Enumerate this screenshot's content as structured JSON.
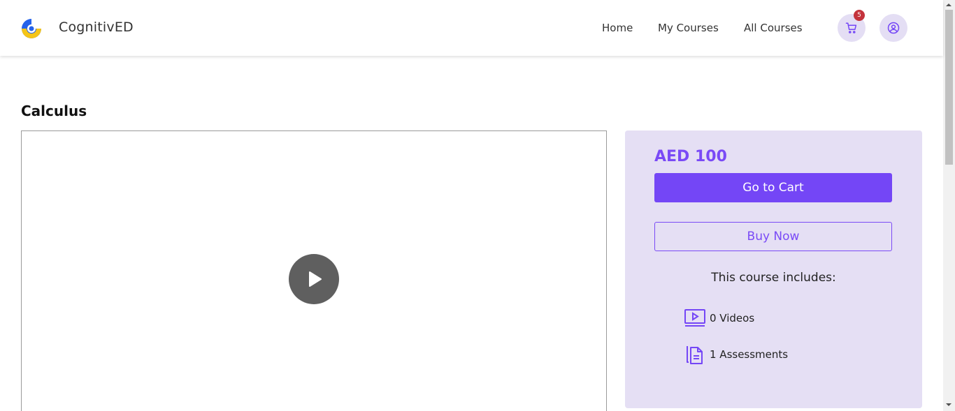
{
  "header": {
    "brand": "CognitivED",
    "nav": [
      "Home",
      "My Courses",
      "All Courses"
    ],
    "cart_count": "5"
  },
  "course": {
    "title": "Calculus"
  },
  "purchase": {
    "price": "AED 100",
    "go_to_cart": "Go to Cart",
    "buy_now": "Buy Now",
    "includes_heading": "This course includes:",
    "videos": "0 Videos",
    "assessments": "1 Assessments"
  },
  "colors": {
    "accent": "#7446f6",
    "panel_bg": "#e5dff4",
    "badge": "#c4333c",
    "logo_blue": "#2563eb",
    "logo_yellow": "#f5c518"
  },
  "icons": {
    "logo": "cognitived-logo-icon",
    "cart": "cart-icon",
    "account": "user-circle-icon",
    "play": "play-icon",
    "videos": "video-player-icon",
    "assessments": "document-icon"
  }
}
